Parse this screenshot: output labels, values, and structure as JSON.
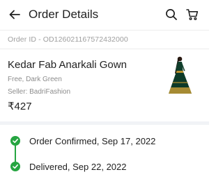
{
  "header": {
    "title": "Order Details",
    "icons": [
      "back-arrow-icon",
      "search-icon",
      "cart-icon"
    ]
  },
  "order": {
    "id_text": "Order ID - OD126021167572432000"
  },
  "product": {
    "name": "Kedar Fab Anarkali Gown",
    "variant": "Free, Dark Green",
    "seller": "Seller: BadriFashion",
    "price": "₹427"
  },
  "tracking": {
    "steps": [
      {
        "label": "Order Confirmed, Sep 17, 2022",
        "status": "done"
      },
      {
        "label": "Delivered, Sep 22, 2022",
        "status": "done"
      }
    ]
  },
  "colors": {
    "accent_green": "#26a541",
    "muted_text": "#9e9e9e",
    "primary_text": "#212121"
  }
}
